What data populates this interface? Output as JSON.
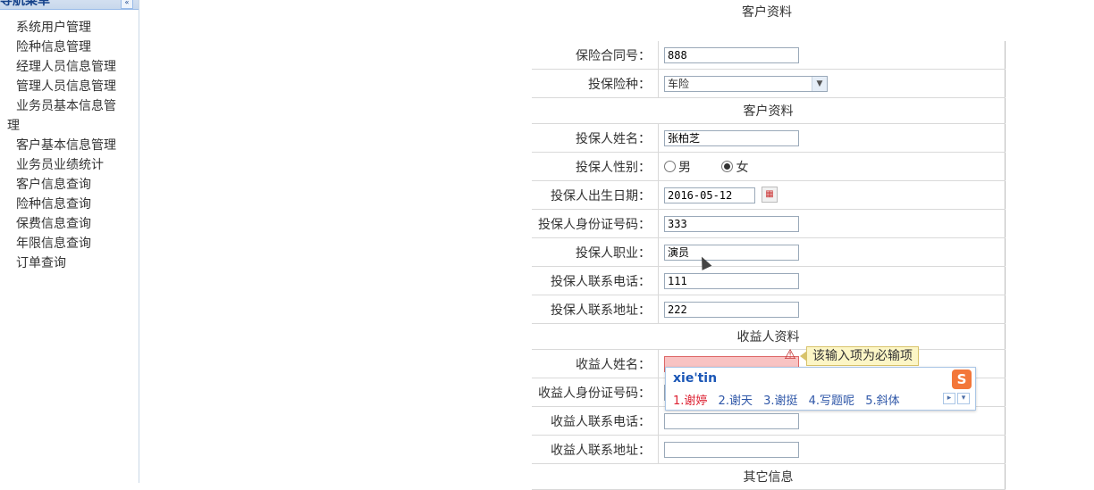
{
  "sidebar": {
    "title": "导航菜单",
    "items": [
      {
        "label": "系统用户管理"
      },
      {
        "label": "险种信息管理"
      },
      {
        "label": "经理人员信息管理"
      },
      {
        "label": "管理人员信息管理"
      },
      {
        "label": "业务员基本信息管",
        "label2": "理"
      },
      {
        "label": "客户基本信息管理"
      },
      {
        "label": "业务员业绩统计"
      },
      {
        "label": "客户信息查询"
      },
      {
        "label": "险种信息查询"
      },
      {
        "label": "保费信息查询"
      },
      {
        "label": "年限信息查询"
      },
      {
        "label": "订单查询"
      }
    ]
  },
  "page": {
    "title": "客户资料"
  },
  "form": {
    "contract_no": {
      "label": "保险合同号：",
      "value": "888"
    },
    "insurance_type": {
      "label": "投保险种：",
      "value": "车险"
    },
    "section_customer": "客户资料",
    "name": {
      "label": "投保人姓名：",
      "value": "张柏芝"
    },
    "gender": {
      "label": "投保人性别：",
      "male": "男",
      "female": "女",
      "selected": "女"
    },
    "birthdate": {
      "label": "投保人出生日期：",
      "value": "2016-05-12"
    },
    "id_no": {
      "label": "投保人身份证号码：",
      "value": "333"
    },
    "job": {
      "label": "投保人职业：",
      "value": "演员"
    },
    "phone": {
      "label": "投保人联系电话：",
      "value": "111"
    },
    "address": {
      "label": "投保人联系地址：",
      "value": "222"
    },
    "section_beneficiary": "收益人资料",
    "b_name": {
      "label": "收益人姓名：",
      "value": ""
    },
    "b_id_no": {
      "label": "收益人身份证号码：",
      "value": ""
    },
    "b_phone": {
      "label": "收益人联系电话：",
      "value": ""
    },
    "b_address": {
      "label": "收益人联系地址：",
      "value": ""
    },
    "section_other": "其它信息"
  },
  "validation": {
    "message": "该输入项为必输项"
  },
  "ime": {
    "composition": "xie'tin",
    "candidates": [
      "1.谢婷",
      "2.谢天",
      "3.谢挺",
      "4.写题呢",
      "5.斜体"
    ]
  },
  "colors": {
    "error_bg": "#f8c3c3",
    "tooltip_bg": "#fcf6c6",
    "sidebar_header": "#15428b"
  }
}
